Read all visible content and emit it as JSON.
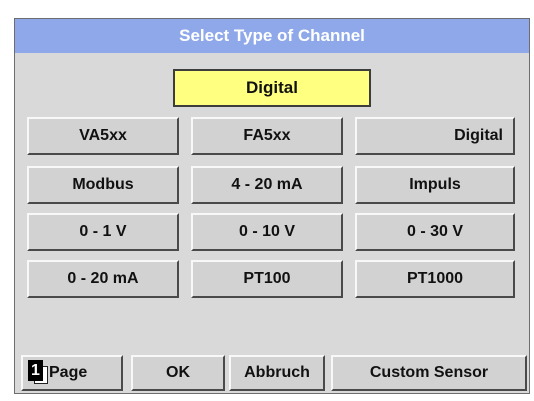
{
  "dialog": {
    "title": "Select Type of Channel",
    "selected_value": "Digital"
  },
  "buttons": [
    [
      "VA5xx",
      "FA5xx",
      "Digital"
    ],
    [
      "Modbus",
      "4 - 20 mA",
      "Impuls"
    ],
    [
      "0 - 1 V",
      "0 - 10 V",
      "0 - 30 V"
    ],
    [
      "0 - 20 mA",
      "PT100",
      "PT1000"
    ]
  ],
  "footer": {
    "page_number": "1",
    "page_label": "Page",
    "ok_label": "OK",
    "abbruch_label": "Abbruch",
    "custom_sensor_label": "Custom Sensor"
  },
  "colors": {
    "title_bar": "#8ea8ea",
    "selected_box": "#ffff80",
    "panel": "#d9d9d9"
  }
}
